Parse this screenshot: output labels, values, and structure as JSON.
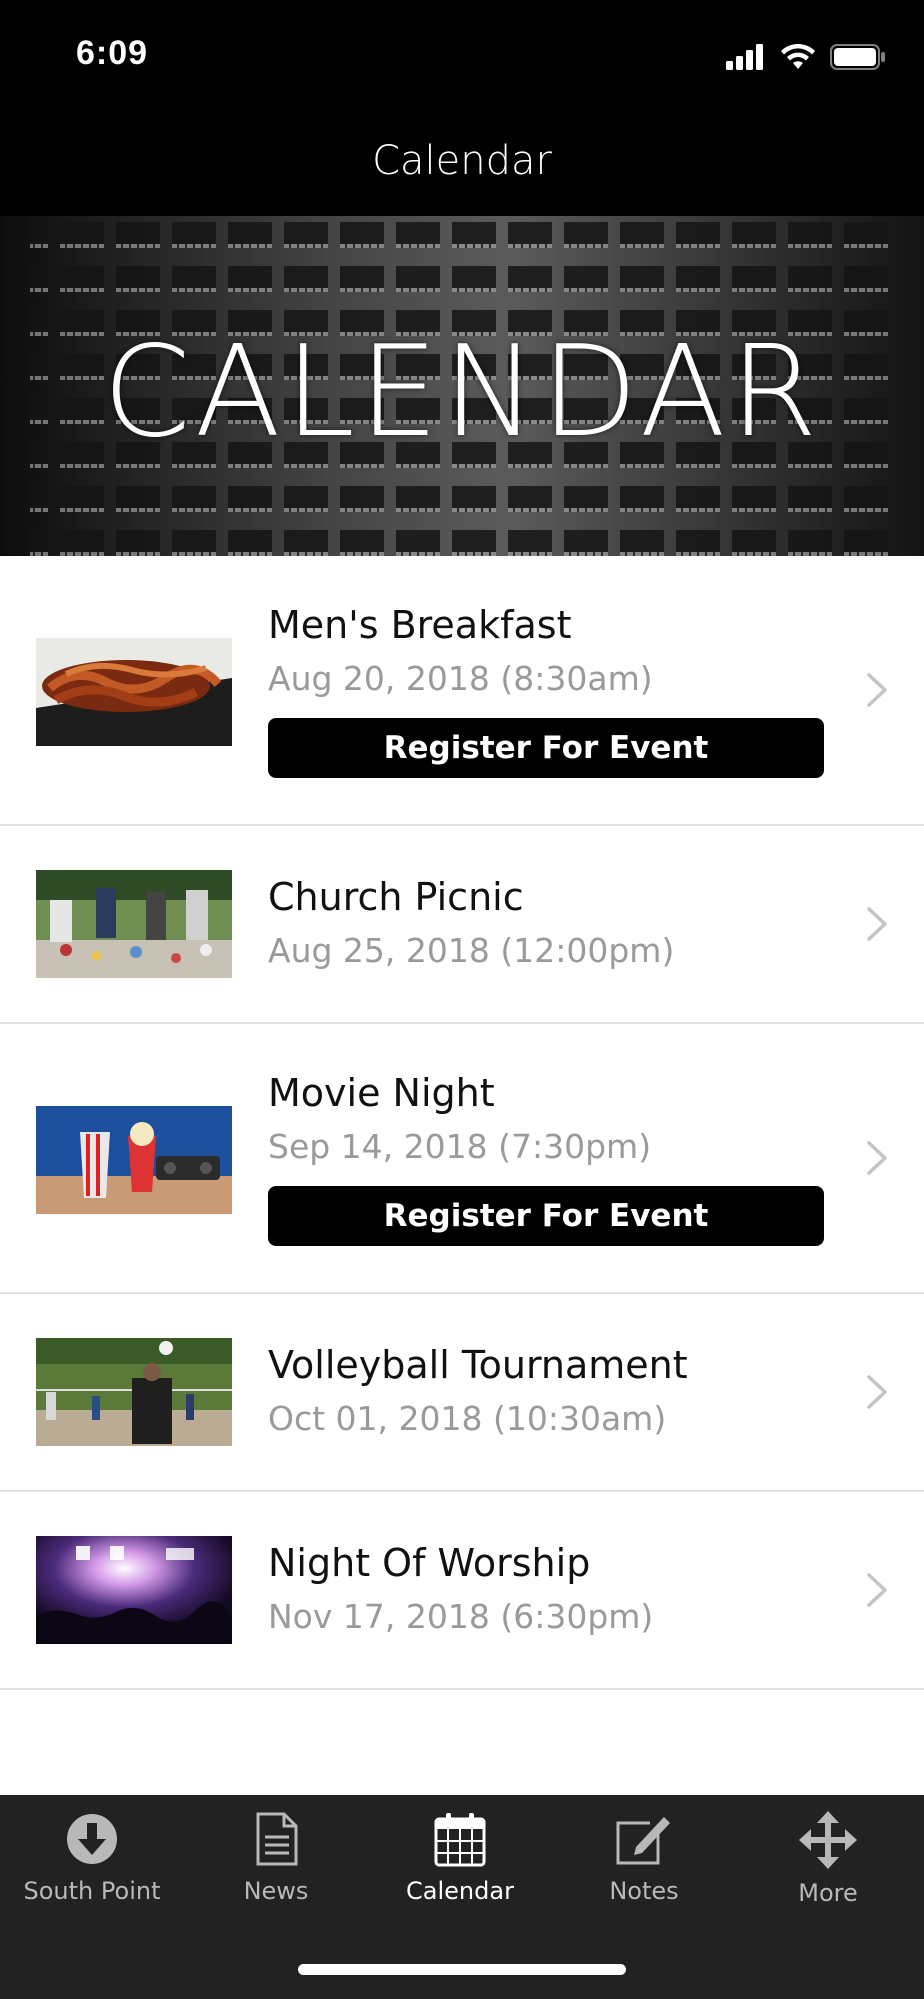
{
  "status_bar": {
    "time": "6:09"
  },
  "nav": {
    "title": "Calendar"
  },
  "hero": {
    "title": "CALENDAR"
  },
  "events": [
    {
      "title": "Men's Breakfast",
      "date": "Aug 20, 2018 (8:30am)",
      "register_label": "Register For Event"
    },
    {
      "title": "Church Picnic",
      "date": "Aug 25, 2018 (12:00pm)"
    },
    {
      "title": "Movie Night",
      "date": "Sep 14, 2018 (7:30pm)",
      "register_label": "Register For Event"
    },
    {
      "title": "Volleyball Tournament",
      "date": "Oct 01, 2018 (10:30am)"
    },
    {
      "title": "Night Of Worship",
      "date": "Nov 17, 2018 (6:30pm)"
    }
  ],
  "tab_bar": {
    "tabs": [
      {
        "label": "South Point",
        "icon": "download-circle-icon"
      },
      {
        "label": "News",
        "icon": "document-icon"
      },
      {
        "label": "Calendar",
        "icon": "calendar-icon",
        "active": true
      },
      {
        "label": "Notes",
        "icon": "edit-note-icon"
      },
      {
        "label": "More",
        "icon": "move-arrows-icon"
      }
    ]
  },
  "colors": {
    "accent": "#000000",
    "tab_active": "#ffffff",
    "tab_inactive": "#b8b8b8",
    "date_gray": "#9a9a9a"
  }
}
